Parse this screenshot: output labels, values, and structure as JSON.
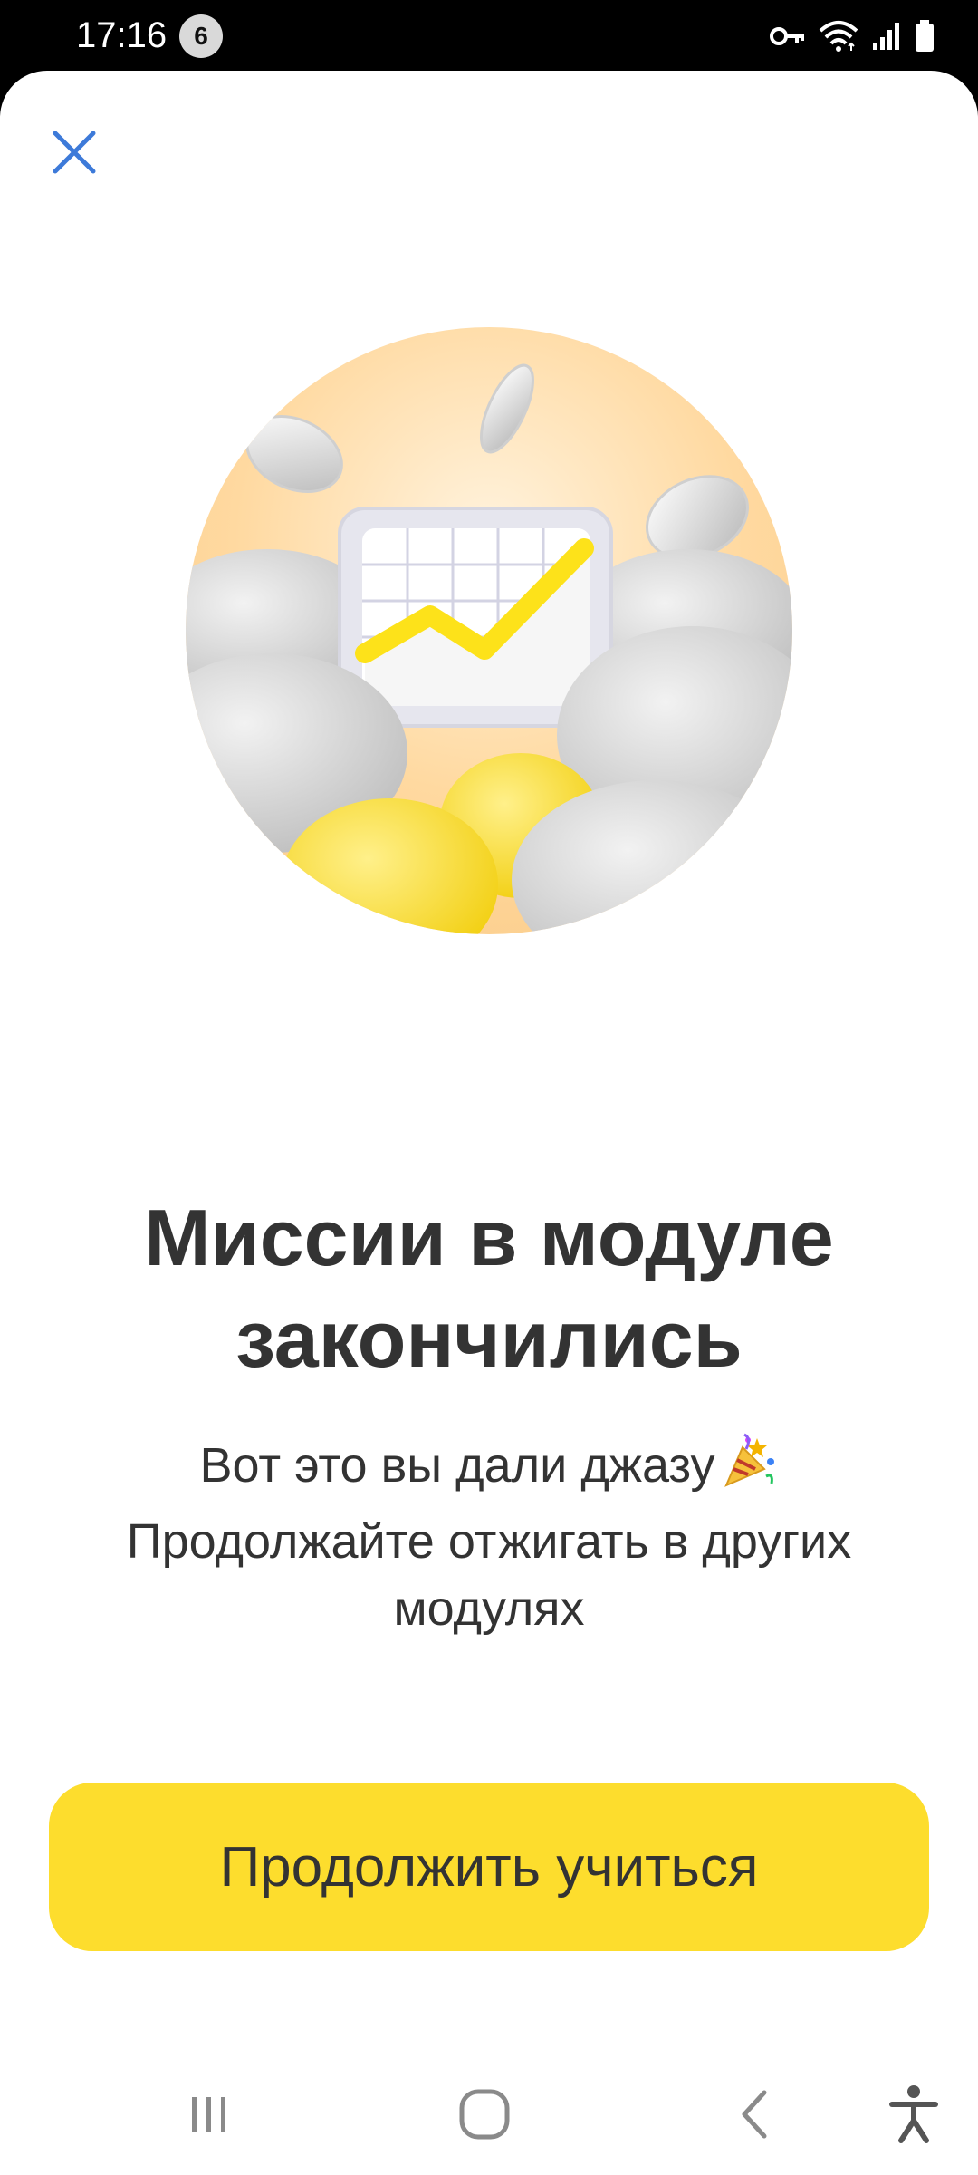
{
  "status_bar": {
    "time": "17:16",
    "notification_count": "6",
    "icons": [
      "vpn-key-icon",
      "wifi-icon",
      "signal-icon",
      "battery-icon"
    ]
  },
  "colors": {
    "accent_yellow": "#fddd2d",
    "close_blue": "#3d7ad9",
    "text_dark": "#333333"
  },
  "dialog": {
    "close_icon": "close-icon",
    "title": "Миссии в модуле закончились",
    "subtitle_line1": "Вот это вы дали джазу",
    "subtitle_emoji": "party-popper-icon",
    "subtitle_line2": "Продолжайте отжигать в других модулях",
    "cta_label": "Продолжить учиться"
  },
  "nav_bar": {
    "items": [
      "recent-apps-icon",
      "home-icon",
      "back-icon",
      "accessibility-icon"
    ]
  }
}
